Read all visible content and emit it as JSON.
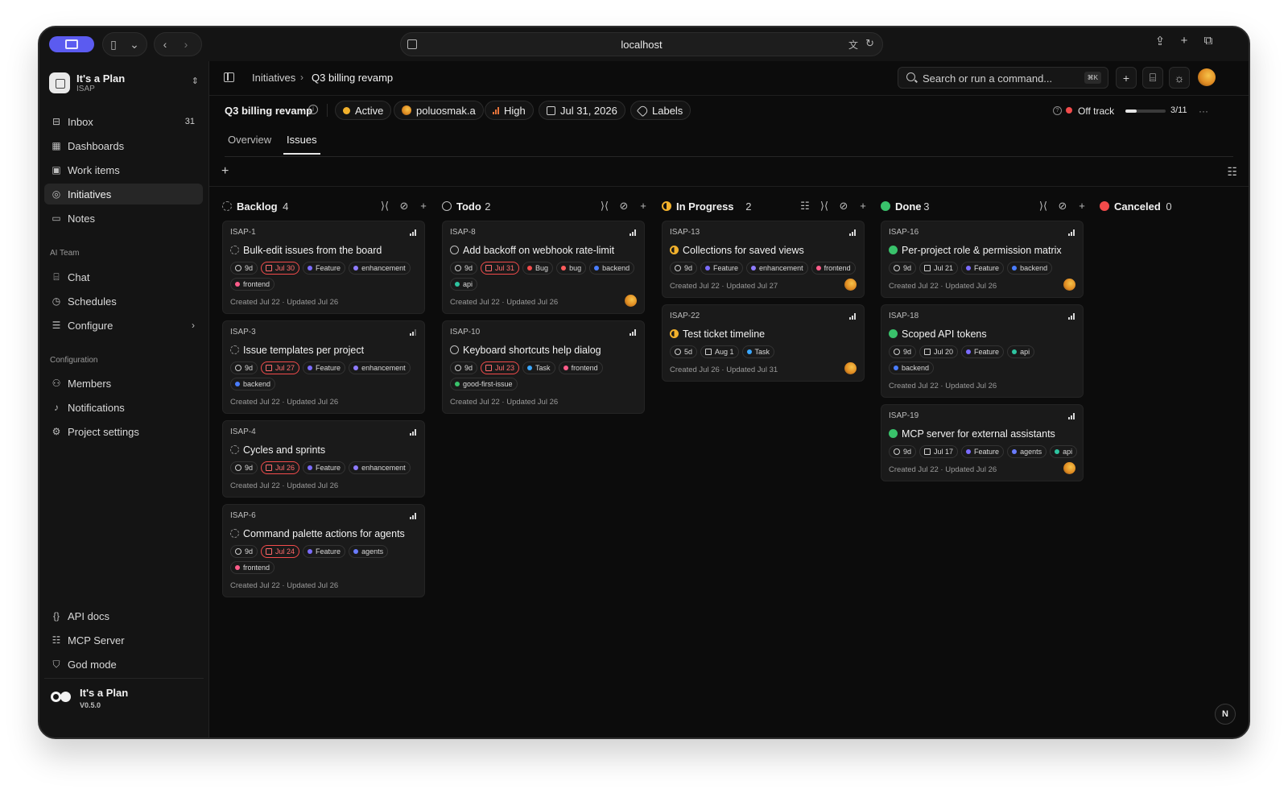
{
  "browser": {
    "url": "localhost"
  },
  "workspace": {
    "name": "It's a Plan",
    "code": "ISAP"
  },
  "sidebar": {
    "items": [
      {
        "label": "Inbox",
        "count": "31",
        "icon": "inbox-icon"
      },
      {
        "label": "Dashboards",
        "icon": "dashboard-icon"
      },
      {
        "label": "Work items",
        "icon": "work-items-icon"
      },
      {
        "label": "Initiatives",
        "icon": "target-icon",
        "active": true
      },
      {
        "label": "Notes",
        "icon": "note-icon"
      }
    ],
    "ai_section": "AI Team",
    "ai_items": [
      {
        "label": "Chat",
        "icon": "chat-icon"
      },
      {
        "label": "Schedules",
        "icon": "clock-icon"
      },
      {
        "label": "Configure",
        "icon": "sliders-icon"
      }
    ],
    "config_section": "Configuration",
    "config_items": [
      {
        "label": "Members",
        "icon": "users-icon"
      },
      {
        "label": "Notifications",
        "icon": "bell-icon"
      },
      {
        "label": "Project settings",
        "icon": "gear-icon"
      }
    ],
    "bottom_items": [
      {
        "label": "API docs",
        "icon": "braces-icon"
      },
      {
        "label": "MCP Server",
        "icon": "server-icon"
      },
      {
        "label": "God mode",
        "icon": "shield-icon"
      }
    ],
    "brand": {
      "name": "It's a Plan",
      "version": "V0.5.0"
    }
  },
  "topbar": {
    "breadcrumb": [
      "Initiatives",
      "Q3 billing revamp"
    ],
    "search_placeholder": "Search or run a command...",
    "search_shortcut": "⌘K"
  },
  "header": {
    "title": "Q3 billing revamp",
    "status": "Active",
    "owner": "poluosmak.a",
    "priority": "High",
    "due": "Jul 31, 2026",
    "labels": "Labels",
    "health": "Off track",
    "progress": "3/11",
    "progress_fraction": 0.27,
    "colors": {
      "active": "#f2b12c",
      "off_track": "#f24b4b",
      "priority": "#e8743b"
    }
  },
  "tabs": [
    "Overview",
    "Issues"
  ],
  "board": {
    "columns": [
      {
        "name": "Backlog",
        "count": "4",
        "status": "backlog",
        "cards": [
          {
            "id": "ISAP-1",
            "title": "Bulk-edit issues from the board",
            "estimate": "9d",
            "due": "Jul 30",
            "labels": [
              {
                "text": "Feature",
                "color": "#7b6cff"
              },
              {
                "text": "enhancement",
                "color": "#8e7bff"
              },
              {
                "text": "frontend",
                "color": "#ff5c8a"
              }
            ],
            "meta": "Created Jul 22 · Updated Jul 26"
          },
          {
            "id": "ISAP-3",
            "title": "Issue templates per project",
            "estimate": "9d",
            "due": "Jul 27",
            "labels": [
              {
                "text": "Feature",
                "color": "#7b6cff"
              },
              {
                "text": "enhancement",
                "color": "#8e7bff"
              },
              {
                "text": "backend",
                "color": "#4a7dff"
              }
            ],
            "meta": "Created Jul 22 · Updated Jul 26"
          },
          {
            "id": "ISAP-4",
            "title": "Cycles and sprints",
            "estimate": "9d",
            "due": "Jul 26",
            "labels": [
              {
                "text": "Feature",
                "color": "#7b6cff"
              },
              {
                "text": "enhancement",
                "color": "#8e7bff"
              }
            ],
            "meta": "Created Jul 22 · Updated Jul 26"
          },
          {
            "id": "ISAP-6",
            "title": "Command palette actions for agents",
            "estimate": "9d",
            "due": "Jul 24",
            "labels": [
              {
                "text": "Feature",
                "color": "#7b6cff"
              },
              {
                "text": "agents",
                "color": "#6a7cff"
              },
              {
                "text": "frontend",
                "color": "#ff5c8a"
              }
            ],
            "meta": "Created Jul 22 · Updated Jul 26"
          }
        ]
      },
      {
        "name": "Todo",
        "count": "2",
        "status": "todo",
        "cards": [
          {
            "id": "ISAP-8",
            "title": "Add backoff on webhook rate-limit",
            "estimate": "9d",
            "due": "Jul 31",
            "labels": [
              {
                "text": "Bug",
                "color": "#f24b4b"
              },
              {
                "text": "bug",
                "color": "#ff5c5c"
              },
              {
                "text": "backend",
                "color": "#4a7dff"
              },
              {
                "text": "api",
                "color": "#2ec4a0"
              }
            ],
            "meta": "Created Jul 22 · Updated Jul 26",
            "avatar": true
          },
          {
            "id": "ISAP-10",
            "title": "Keyboard shortcuts help dialog",
            "estimate": "9d",
            "due": "Jul 23",
            "labels": [
              {
                "text": "Task",
                "color": "#3aa7ff"
              },
              {
                "text": "frontend",
                "color": "#ff5c8a"
              },
              {
                "text": "good-first-issue",
                "color": "#39c26b"
              }
            ],
            "meta": "Created Jul 22 · Updated Jul 26"
          }
        ]
      },
      {
        "name": "In Progress",
        "count": "2",
        "status": "progress",
        "cards": [
          {
            "id": "ISAP-13",
            "title": "Collections for saved views",
            "estimate": "9d",
            "labels": [
              {
                "text": "Feature",
                "color": "#7b6cff"
              },
              {
                "text": "enhancement",
                "color": "#8e7bff"
              },
              {
                "text": "frontend",
                "color": "#ff5c8a"
              }
            ],
            "meta": "Created Jul 22 · Updated Jul 27",
            "avatar": true
          },
          {
            "id": "ISAP-22",
            "title": "Test ticket timeline",
            "estimate": "5d",
            "date": "Aug 1",
            "labels": [
              {
                "text": "Task",
                "color": "#3aa7ff"
              }
            ],
            "meta": "Created Jul 26 · Updated Jul 31",
            "avatar": true
          }
        ]
      },
      {
        "name": "Done",
        "count": "3",
        "status": "done",
        "cards": [
          {
            "id": "ISAP-16",
            "title": "Per-project role & permission matrix",
            "estimate": "9d",
            "date": "Jul 21",
            "labels": [
              {
                "text": "Feature",
                "color": "#7b6cff"
              },
              {
                "text": "backend",
                "color": "#4a7dff"
              }
            ],
            "meta": "Created Jul 22 · Updated Jul 26",
            "avatar": true
          },
          {
            "id": "ISAP-18",
            "title": "Scoped API tokens",
            "estimate": "9d",
            "date": "Jul 20",
            "labels": [
              {
                "text": "Feature",
                "color": "#7b6cff"
              },
              {
                "text": "api",
                "color": "#2ec4a0"
              },
              {
                "text": "backend",
                "color": "#4a7dff"
              }
            ],
            "meta": "Created Jul 22 · Updated Jul 26"
          },
          {
            "id": "ISAP-19",
            "title": "MCP server for external assistants",
            "estimate": "9d",
            "date": "Jul 17",
            "labels": [
              {
                "text": "Feature",
                "color": "#7b6cff"
              },
              {
                "text": "agents",
                "color": "#6a7cff"
              },
              {
                "text": "api",
                "color": "#2ec4a0"
              }
            ],
            "meta": "Created Jul 22 · Updated Jul 26",
            "avatar": true
          }
        ]
      },
      {
        "name": "Canceled",
        "count": "0",
        "status": "cancel",
        "cards": []
      }
    ]
  },
  "corner_badge": "N"
}
